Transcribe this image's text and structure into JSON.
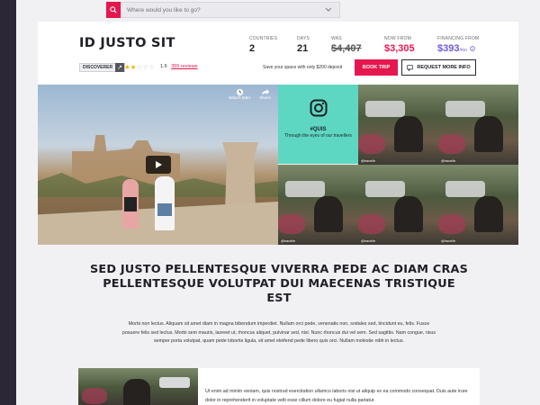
{
  "search": {
    "placeholder": "Where would you like to go?"
  },
  "trip": {
    "title": "ID JUSTO SIT",
    "stats": {
      "countries_label": "COUNTRIES",
      "countries": "2",
      "days_label": "DAYS",
      "days": "21",
      "was_label": "WAS",
      "was": "$4,407",
      "now_label": "NOW FROM",
      "now": "$3,305",
      "financing_label": "FINANCING FROM",
      "financing": "$393",
      "financing_unit": "/mo"
    },
    "badge": "DISCOVERER",
    "rating_stars": 1.6,
    "rating_value": "1.6",
    "reviews": "355 reviews",
    "deposit_text": "Save your space with only $200 deposit",
    "book_label": "BOOK TRIP",
    "info_label": "REQUEST MORE INFO"
  },
  "media": {
    "watch_later": "Watch later",
    "share": "Share",
    "insta_hashtag": "#QUIS",
    "insta_sub": "Through the eyes of our travellers",
    "thumb_tags": [
      "@travelle",
      "@travelle",
      "@travelle",
      "@travelle",
      "@travelle",
      "@travelle",
      "@travelle"
    ]
  },
  "content": {
    "headline": "SED JUSTO PELLENTESQUE VIVERRA PEDE AC DIAM CRAS PELLENTESQUE VOLUTPAT DUI MAECENAS TRISTIQUE EST",
    "body": "Morbi non lectus. Aliquam sit amet diam in magna bibendum imperdiet. Nullam orci pede, venenatis non, sodales sed, tincidunt eu, felis. Fusce posuere felis sed lectus. Morbi sem mauris, laoreet ut, rhoncus aliquet, pulvinar sed, nisl. Nunc rhoncus dui vel sem. Sed sagittis. Nam congue, risus semper porta volutpat, quam pede lobortis ligula, sit amet eleifend pede libero quis orci. Nullam molestie nibh in lectus.",
    "lower": "Ut enim ad minim veniam, quis nostrud exercitation ullamco laboris nisi ut aliquip ex ea commodo consequat. Duis aute irure dolor in reprehenderit in voluptate velit esse cillum dolore eu fugiat nulla pariatur."
  },
  "colors": {
    "accent": "#e6174f",
    "finance": "#6a5bd6",
    "instagram_tile": "#5ed7c2",
    "sidebar": "#2b2737"
  },
  "icons": [
    "search-icon",
    "chevron-down-icon",
    "arrow-icon",
    "star-icon",
    "info-icon",
    "clock-icon",
    "share-icon",
    "play-icon",
    "instagram-icon"
  ]
}
